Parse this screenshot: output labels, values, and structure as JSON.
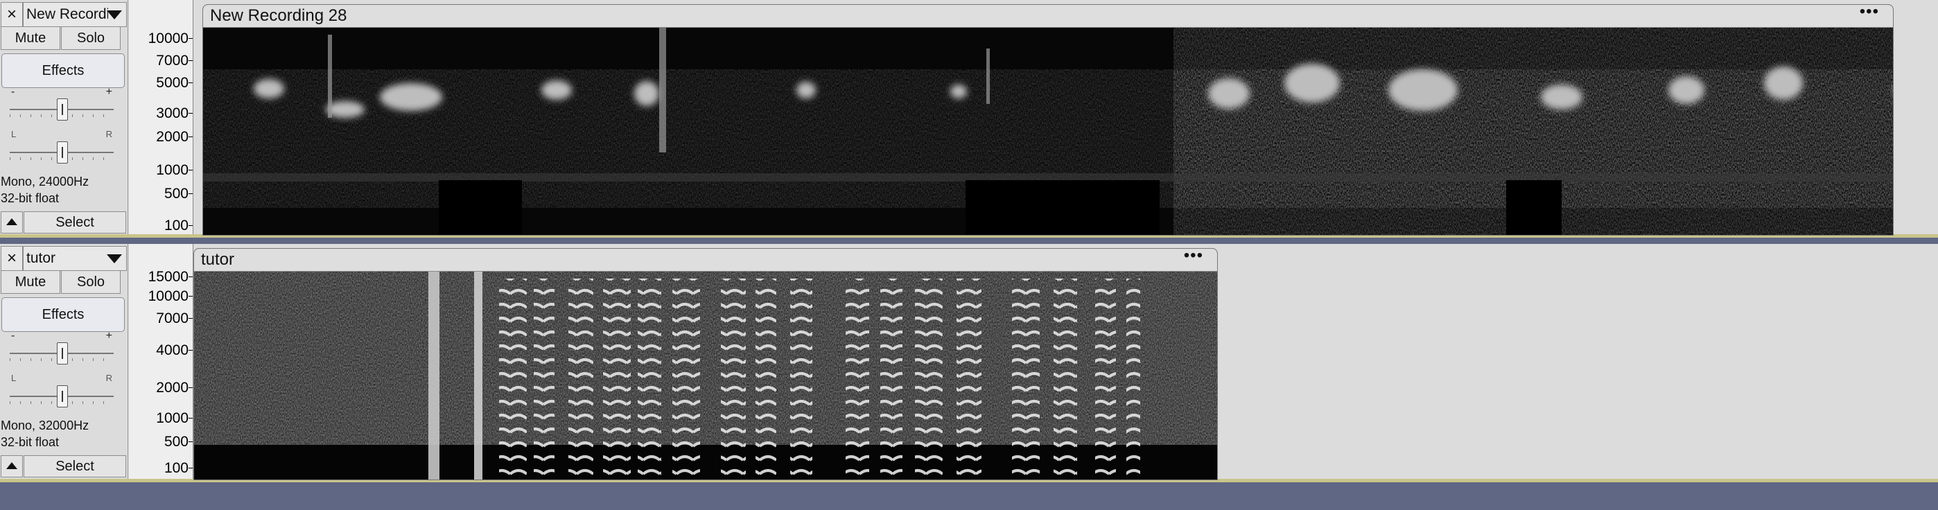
{
  "tracks": [
    {
      "name_button": "New Recordin",
      "mute": "Mute",
      "solo": "Solo",
      "effects": "Effects",
      "gain_minus": "-",
      "gain_plus": "+",
      "pan_left": "L",
      "pan_right": "R",
      "info_line1": "Mono, 24000Hz",
      "info_line2": "32-bit float",
      "select": "Select",
      "ruler_ticks": [
        "10000",
        "7000",
        "5000",
        "3000",
        "2000",
        "1000",
        "500",
        "100"
      ],
      "clip_title": "New Recording 28",
      "clip_menu": "•••"
    },
    {
      "name_button": "tutor",
      "mute": "Mute",
      "solo": "Solo",
      "effects": "Effects",
      "gain_minus": "-",
      "gain_plus": "+",
      "pan_left": "L",
      "pan_right": "R",
      "info_line1": "Mono, 32000Hz",
      "info_line2": "32-bit float",
      "select": "Select",
      "ruler_ticks": [
        "15000",
        "10000",
        "7000",
        "4000",
        "2000",
        "1000",
        "500",
        "100"
      ],
      "clip_title": "tutor",
      "clip_menu": "•••"
    }
  ],
  "icons": {
    "close": "close-icon",
    "dropdown": "chevron-down-icon",
    "collapse": "collapse-triangle-icon"
  },
  "colors": {
    "panel": "#dcdcdc",
    "spectrogram_bg": "#050505",
    "track_separator": "#c9c48a",
    "workspace_bg": "#5f6784"
  }
}
